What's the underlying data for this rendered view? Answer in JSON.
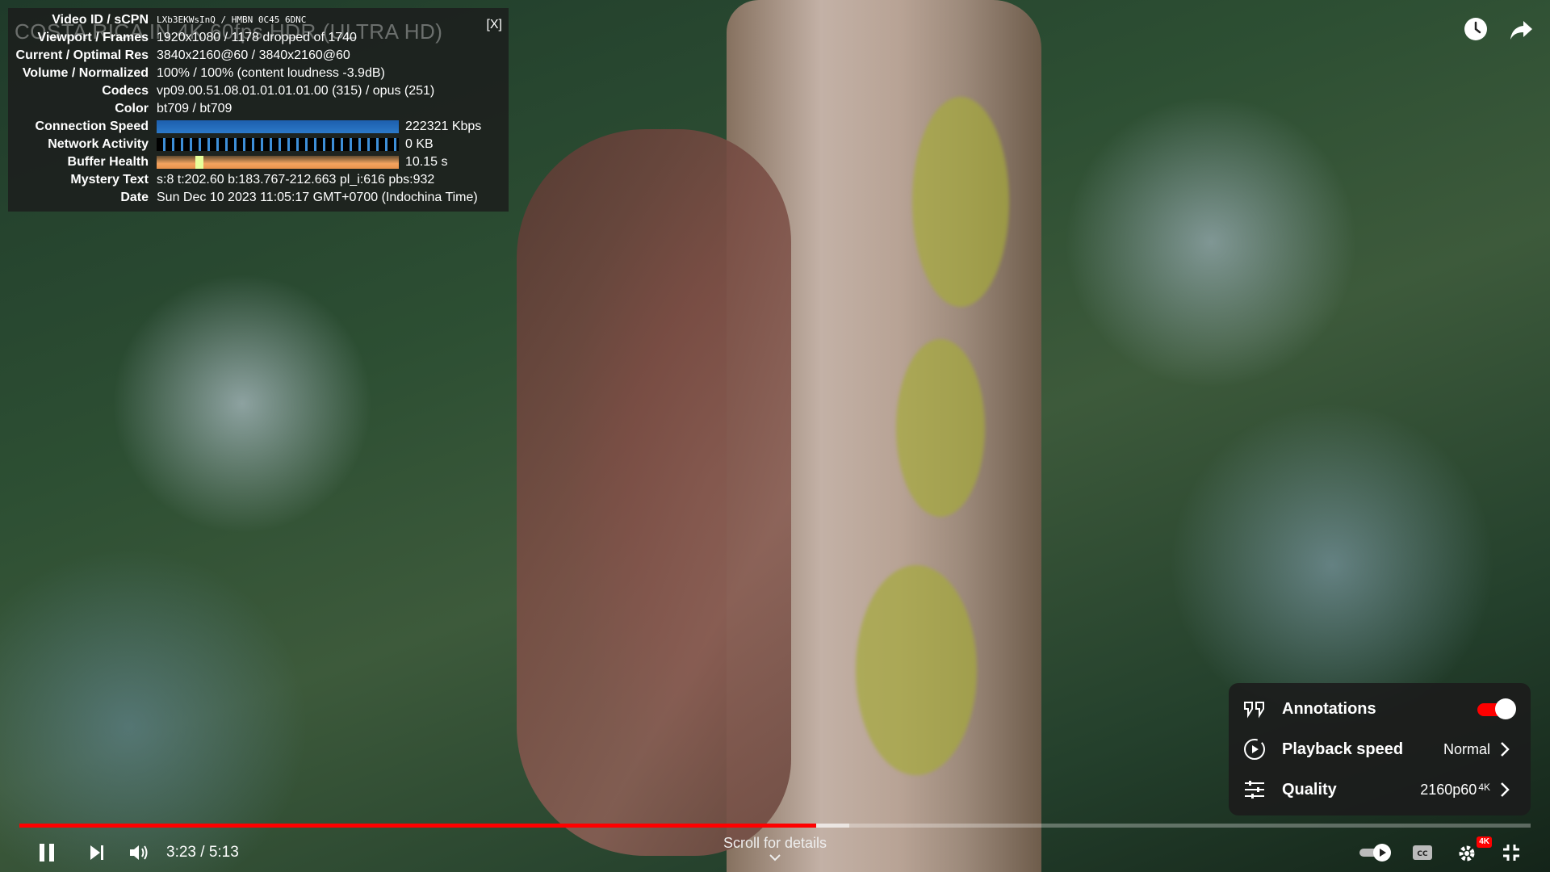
{
  "stats": {
    "ghost_title": "COSTA RICA IN 4K 60fps HDR (ULTRA HD)",
    "close_label": "[X]",
    "rows": [
      {
        "label": "Video ID / sCPN",
        "value": "LXb3EKWsInQ  /  HMBN 0C45 6DNC"
      },
      {
        "label": "Viewport / Frames",
        "value": "1920x1080 / 1178 dropped of 1740"
      },
      {
        "label": "Current / Optimal Res",
        "value": "3840x2160@60 / 3840x2160@60"
      },
      {
        "label": "Volume / Normalized",
        "value": "100% / 100% (content loudness -3.9dB)"
      },
      {
        "label": "Codecs",
        "value": "vp09.00.51.08.01.01.01.01.00 (315) / opus (251)"
      },
      {
        "label": "Color",
        "value": "bt709 / bt709"
      },
      {
        "label": "Connection Speed",
        "value": "222321 Kbps"
      },
      {
        "label": "Network Activity",
        "value": "0 KB"
      },
      {
        "label": "Buffer Health",
        "value": "10.15 s"
      },
      {
        "label": "Mystery Text",
        "value": "s:8 t:202.60 b:183.767-212.663 pl_i:616 pbs:932"
      },
      {
        "label": "Date",
        "value": "Sun Dec 10 2023 11:05:17 GMT+0700 (Indochina Time)"
      }
    ]
  },
  "top_icons": [
    "watch-later-icon",
    "share-icon"
  ],
  "settings_menu": {
    "annotations": {
      "label": "Annotations",
      "on": true
    },
    "playback_speed": {
      "label": "Playback speed",
      "value": "Normal"
    },
    "quality": {
      "label": "Quality",
      "value": "2160p60",
      "badge": "4K"
    }
  },
  "progress": {
    "played_fraction": 0.527,
    "buffered_fraction": 0.549
  },
  "controls": {
    "current_time": "3:23",
    "separator": " / ",
    "duration": "5:13",
    "scroll_hint": "Scroll for details",
    "settings_badge": "4K"
  },
  "colors": {
    "accent": "#ff0000",
    "panel": "#1c1c1c"
  }
}
